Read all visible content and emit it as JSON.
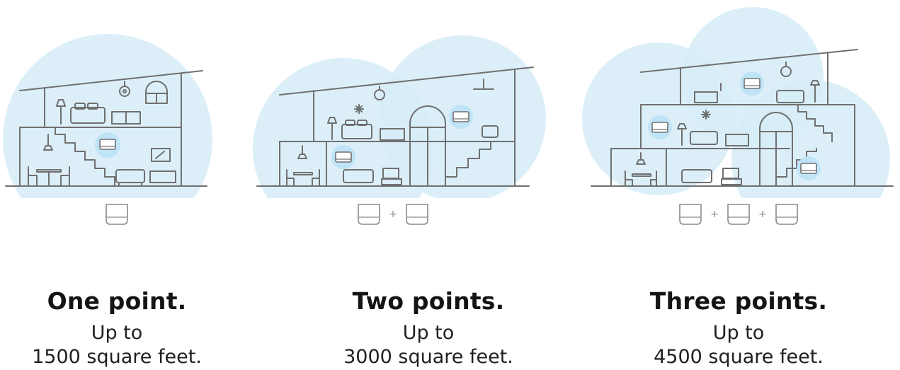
{
  "colors": {
    "coverage": "#d6ecf8",
    "coverage_center": "#c4e4f6",
    "line": "#707070",
    "device_badge": "#bfe3f7"
  },
  "panels": [
    {
      "title": "One point.",
      "line1": "Up to",
      "line2": "1500 square feet.",
      "device_count": 1,
      "plus_sign": ""
    },
    {
      "title": "Two points.",
      "line1": "Up to",
      "line2": "3000 square feet.",
      "device_count": 2,
      "plus_sign": "+"
    },
    {
      "title": "Three points.",
      "line1": "Up to",
      "line2": "4500 square feet.",
      "device_count": 3,
      "plus_sign": "+"
    }
  ]
}
